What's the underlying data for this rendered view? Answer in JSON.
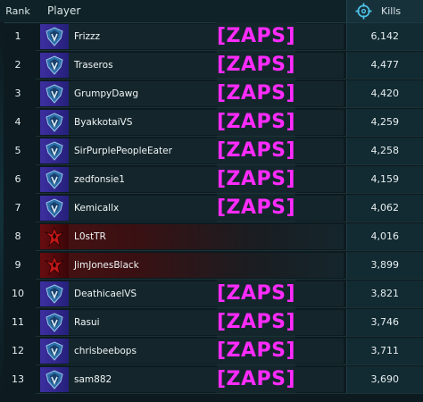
{
  "header": {
    "rank_label": "Rank",
    "player_label": "Player",
    "kills_label": "Kills",
    "kills_icon": "crosshair-icon"
  },
  "colors": {
    "zaps": "#ff2bff",
    "nc_faction": "#3d2fa0",
    "tr_faction": "#6a0d10"
  },
  "rows": [
    {
      "rank": "1",
      "name": "Frizzz",
      "kills": "6,142",
      "faction": "nc",
      "tag": "[ZAPS]"
    },
    {
      "rank": "2",
      "name": "Traseros",
      "kills": "4,477",
      "faction": "nc",
      "tag": "[ZAPS]"
    },
    {
      "rank": "3",
      "name": "GrumpyDawg",
      "kills": "4,420",
      "faction": "nc",
      "tag": "[ZAPS]"
    },
    {
      "rank": "4",
      "name": "ByakkotaiVS",
      "kills": "4,259",
      "faction": "nc",
      "tag": "[ZAPS]"
    },
    {
      "rank": "5",
      "name": "SirPurplePeopleEater",
      "kills": "4,258",
      "faction": "nc",
      "tag": "[ZAPS]"
    },
    {
      "rank": "6",
      "name": "zedfonsie1",
      "kills": "4,159",
      "faction": "nc",
      "tag": "[ZAPS]"
    },
    {
      "rank": "7",
      "name": "Kemicallx",
      "kills": "4,062",
      "faction": "nc",
      "tag": "[ZAPS]"
    },
    {
      "rank": "8",
      "name": "L0stTR",
      "kills": "4,016",
      "faction": "tr",
      "tag": ""
    },
    {
      "rank": "9",
      "name": "JimJonesBlack",
      "kills": "3,899",
      "faction": "tr",
      "tag": ""
    },
    {
      "rank": "10",
      "name": "DeathicaelVS",
      "kills": "3,821",
      "faction": "nc",
      "tag": "[ZAPS]"
    },
    {
      "rank": "11",
      "name": "Rasui",
      "kills": "3,746",
      "faction": "nc",
      "tag": "[ZAPS]"
    },
    {
      "rank": "12",
      "name": "chrisbeebops",
      "kills": "3,711",
      "faction": "nc",
      "tag": "[ZAPS]"
    },
    {
      "rank": "13",
      "name": "sam882",
      "kills": "3,690",
      "faction": "nc",
      "tag": "[ZAPS]"
    }
  ]
}
